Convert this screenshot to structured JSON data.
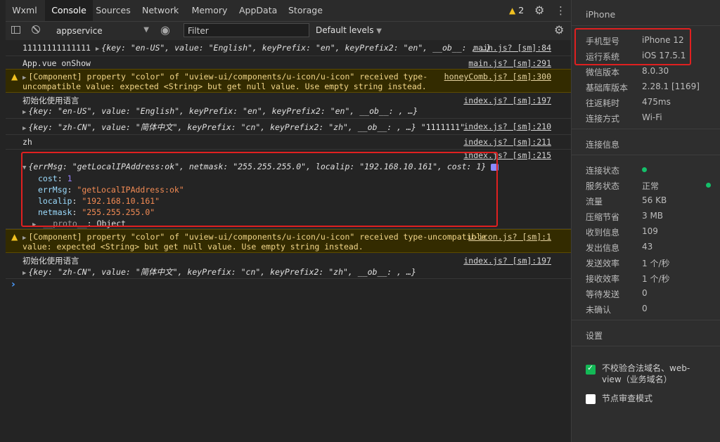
{
  "tabs": [
    "Wxml",
    "Console",
    "Sources",
    "Network",
    "Memory",
    "AppData",
    "Storage"
  ],
  "warning_count": "2",
  "toolbar": {
    "context": "appservice",
    "filter_placeholder": "Filter",
    "levels": "Default levels"
  },
  "console": {
    "r1": {
      "text": "11111111111111",
      "obj": "{key: \"en-US\", value: \"English\", keyPrefix: \"en\", keyPrefix2: \"en\", __ob__: , …}",
      "src": "main.js? [sm]:84"
    },
    "r2": {
      "text": "App.vue onShow",
      "src": "main.js? [sm]:291"
    },
    "r3": {
      "line1": "[Component] property \"color\" of \"uview-ui/components/u-icon/u-icon\" received type-",
      "line2": "uncompatible value: expected <String> but get null value. Use empty string instead.",
      "src": "honeyComb.js? [sm]:300"
    },
    "r4": {
      "text": "初始化使用语言",
      "obj": "{key: \"en-US\", value: \"English\", keyPrefix: \"en\", keyPrefix2: \"en\", __ob__: , …}",
      "src": "index.js? [sm]:197"
    },
    "r5": {
      "obj": "{key: \"zh-CN\", value: \"简体中文\", keyPrefix: \"cn\", keyPrefix2: \"zh\", __ob__: , …}",
      "tail": "\"1111111\"",
      "src": "index.js? [sm]:210"
    },
    "r6": {
      "text": "zh",
      "src": "index.js? [sm]:211"
    },
    "r7": {
      "summary": "{errMsg: \"getLocalIPAddress:ok\", netmask: \"255.255.255.0\", localip: \"192.168.10.161\", cost: 1}",
      "src": "index.js? [sm]:215",
      "props": [
        {
          "key": "cost",
          "val": "1"
        },
        {
          "key": "errMsg",
          "val": "\"getLocalIPAddress:ok\""
        },
        {
          "key": "localip",
          "val": "\"192.168.10.161\""
        },
        {
          "key": "netmask",
          "val": "\"255.255.255.0\""
        },
        {
          "key": "__proto__",
          "val": "Object"
        }
      ]
    },
    "r8": {
      "line1": "[Component] property \"color\" of \"uview-ui/components/u-icon/u-icon\" received type-uncompatible",
      "line2": "value: expected <String> but get null value. Use empty string instead.",
      "src": "u-icon.js? [sm]:1"
    },
    "r9": {
      "text": "初始化使用语言",
      "obj": "{key: \"zh-CN\", value: \"简体中文\", keyPrefix: \"cn\", keyPrefix2: \"zh\", __ob__: , …}",
      "src": "index.js? [sm]:197"
    },
    "prompt": "›"
  },
  "panel": {
    "device": "iPhone",
    "info": [
      {
        "label": "手机型号",
        "value": "iPhone 12"
      },
      {
        "label": "运行系统",
        "value": "iOS 17.5.1"
      },
      {
        "label": "微信版本",
        "value": "8.0.30"
      },
      {
        "label": "基础库版本",
        "value": "2.28.1 [1169]"
      },
      {
        "label": "往返耗时",
        "value": "475ms"
      },
      {
        "label": "连接方式",
        "value": "Wi-Fi"
      }
    ],
    "conn_title": "连接信息",
    "conn": [
      {
        "label": "连接状态",
        "value": ""
      },
      {
        "label": "服务状态",
        "value": "正常"
      },
      {
        "label": "流量",
        "value": "56 KB"
      },
      {
        "label": "压缩节省",
        "value": "3 MB"
      },
      {
        "label": "收到信息",
        "value": "109"
      },
      {
        "label": "发出信息",
        "value": "43"
      },
      {
        "label": "发送效率",
        "value": "1 个/秒"
      },
      {
        "label": "接收效率",
        "value": "1 个/秒"
      },
      {
        "label": "等待发送",
        "value": "0"
      },
      {
        "label": "未确认",
        "value": "0"
      }
    ],
    "settings_title": "设置",
    "opt1_line1": "不校验合法域名、web-",
    "opt1_line2": "view（业务域名）",
    "opt2": "节点审查模式"
  }
}
